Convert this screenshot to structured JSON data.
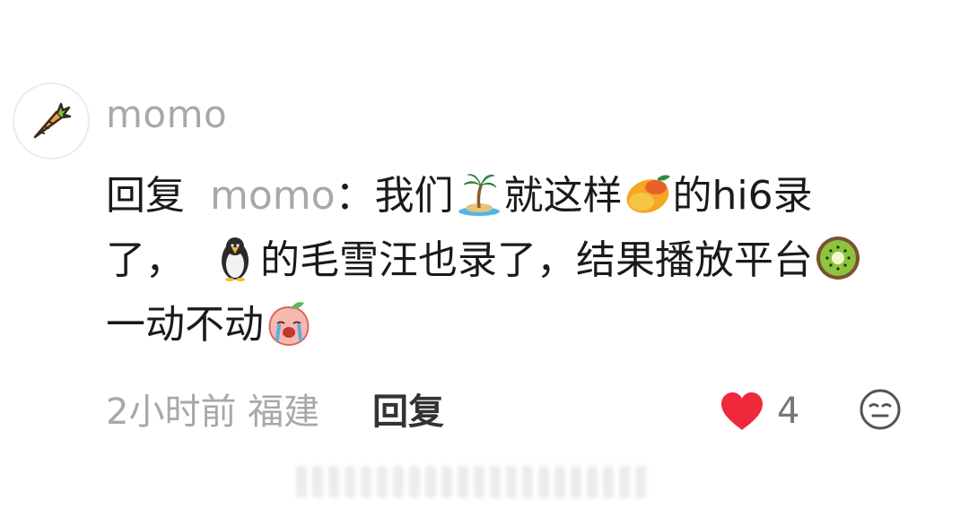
{
  "comment": {
    "avatar_icon": "carrot-icon",
    "username": "momo",
    "reply_prefix": "回复",
    "mention": "momo",
    "text": {
      "part1": "：我们",
      "part2": "就这样",
      "part3": "的hi6录了，",
      "part4": "的毛雪汪也录了，结果播放平台",
      "part5": "一动不动"
    },
    "emojis": [
      "island-icon",
      "mango-icon",
      "penguin-icon",
      "kiwi-icon",
      "crying-peach-icon"
    ],
    "time": "2小时前",
    "location": "福建",
    "reply_label": "回复",
    "like_count": "4",
    "like_color": "#f0283c"
  }
}
